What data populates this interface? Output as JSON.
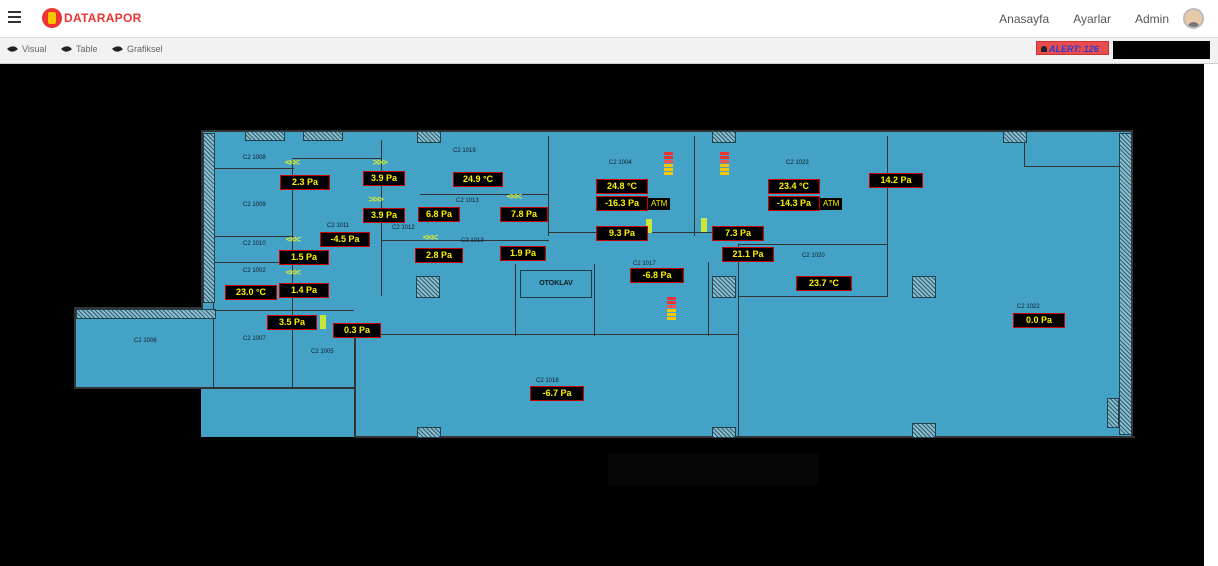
{
  "app": {
    "brand": "DATARAPOR"
  },
  "nav": {
    "items": [
      "Anasayfa",
      "Ayarlar",
      "Admin"
    ]
  },
  "toolbar": {
    "buttons": [
      "Visual",
      "Table",
      "Grafiksel"
    ],
    "alert": "ALERT: 126"
  },
  "otoklav": "OTOKLAV",
  "rooms": [
    "C2 1008",
    "C2 1009",
    "C2 1010",
    "C2 1002",
    "C2 1011",
    "C2 1007",
    "C2 1006",
    "C2 1005",
    "C2 1019",
    "C2 1012",
    "C2 1013",
    "C2 1004",
    "C2 1017",
    "C2 1018",
    "C2 1023",
    "C2 1020",
    "C2 1022"
  ],
  "sensors": [
    "2.3 Pa",
    "3.9 Pa",
    "24.9 °C",
    "3.9 Pa",
    "6.8 Pa",
    "7.8 Pa",
    "-4.5 Pa",
    "2.8 Pa",
    "1.9 Pa",
    "1.5 Pa",
    "1.4 Pa",
    "23.0 °C",
    "3.5 Pa",
    "0.3 Pa",
    "24.8 °C",
    "-16.3 Pa",
    "9.3 Pa",
    "-6.8 Pa",
    "-6.7 Pa",
    "23.4 °C",
    "-14.3 Pa",
    "7.3 Pa",
    "21.1 Pa",
    "23.7 °C",
    "14.2 Pa",
    "0.0 Pa"
  ],
  "atm": [
    "ATM",
    "ATM"
  ],
  "colors": {
    "plan": "#45a2c7",
    "value_text": "#fff200",
    "value_border": "#cc0000",
    "alert_bg": "#e84c4c",
    "alert_text": "#2c3bd6"
  }
}
